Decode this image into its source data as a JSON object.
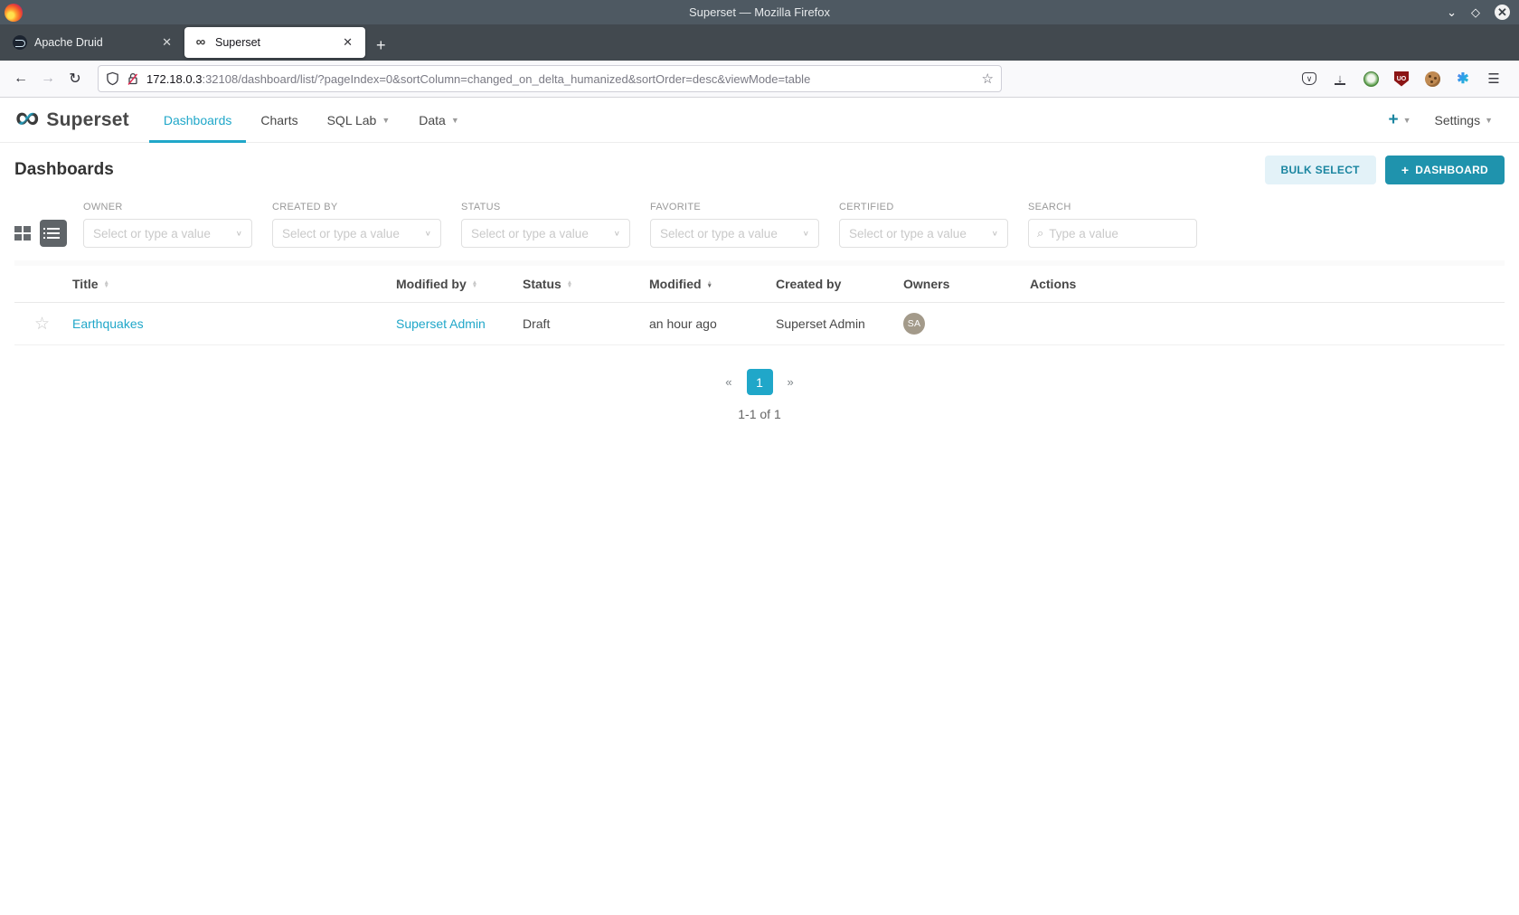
{
  "colors": {
    "primary": "#20A7C9",
    "primary_dark": "#1A85A0",
    "button_primary_bg": "#1f93ad",
    "bulk_select_bg": "#e3f2f8",
    "titlebar_bg": "#4e5962",
    "tabbar_bg": "#42494f",
    "avatar_bg": "#a39a8a"
  },
  "window": {
    "title": "Superset — Mozilla Firefox"
  },
  "icons": {
    "minimize": "⌄",
    "maximize": "◇",
    "close": "✕",
    "tab_close": "✕",
    "new_tab": "+",
    "back": "←",
    "forward": "→",
    "reload": "↻",
    "bookmark_star": "☆",
    "download_arrow": "↓",
    "pocket_chevron": "∨",
    "ublock_text": "UO",
    "spark": "✱",
    "menu": "☰",
    "superset_favicon": "∞",
    "brand_infinity": "∞",
    "caret_down": "▼",
    "plus": "+",
    "sort_up": "▲",
    "sort_down": "▼",
    "chevron_down": "∨",
    "magnifier": "⌕",
    "favorite_star": "☆",
    "prev": "«",
    "next": "»"
  },
  "browser": {
    "tabs": [
      {
        "label": "Apache Druid",
        "active": false
      },
      {
        "label": "Superset",
        "active": true
      }
    ],
    "url_host": "172.18.0.3",
    "url_rest": ":32108/dashboard/list/?pageIndex=0&sortColumn=changed_on_delta_humanized&sortOrder=desc&viewMode=table"
  },
  "navbar": {
    "brand": "Superset",
    "items": [
      {
        "label": "Dashboards",
        "active": true,
        "caret": false
      },
      {
        "label": "Charts",
        "active": false,
        "caret": false
      },
      {
        "label": "SQL Lab",
        "active": false,
        "caret": true
      },
      {
        "label": "Data",
        "active": false,
        "caret": true
      }
    ],
    "settings_label": "Settings"
  },
  "page": {
    "title": "Dashboards",
    "bulk_select_label": "BULK SELECT",
    "new_dashboard_label": "DASHBOARD"
  },
  "filters": [
    {
      "label": "OWNER",
      "placeholder": "Select or type a value"
    },
    {
      "label": "CREATED BY",
      "placeholder": "Select or type a value"
    },
    {
      "label": "STATUS",
      "placeholder": "Select or type a value"
    },
    {
      "label": "FAVORITE",
      "placeholder": "Select or type a value"
    },
    {
      "label": "CERTIFIED",
      "placeholder": "Select or type a value"
    }
  ],
  "search": {
    "label": "SEARCH",
    "placeholder": "Type a value"
  },
  "table": {
    "columns": [
      {
        "label": "Title",
        "sortable": true
      },
      {
        "label": "Modified by",
        "sortable": true
      },
      {
        "label": "Status",
        "sortable": true
      },
      {
        "label": "Modified",
        "sortable": true,
        "sorted": "desc"
      },
      {
        "label": "Created by",
        "sortable": false
      },
      {
        "label": "Owners",
        "sortable": false
      },
      {
        "label": "Actions",
        "sortable": false
      }
    ],
    "rows": [
      {
        "title": "Earthquakes",
        "modified_by": "Superset Admin",
        "status": "Draft",
        "modified": "an hour ago",
        "created_by": "Superset Admin",
        "owner_initials": "SA"
      }
    ]
  },
  "pagination": {
    "current_page": "1",
    "summary": "1-1 of 1"
  }
}
